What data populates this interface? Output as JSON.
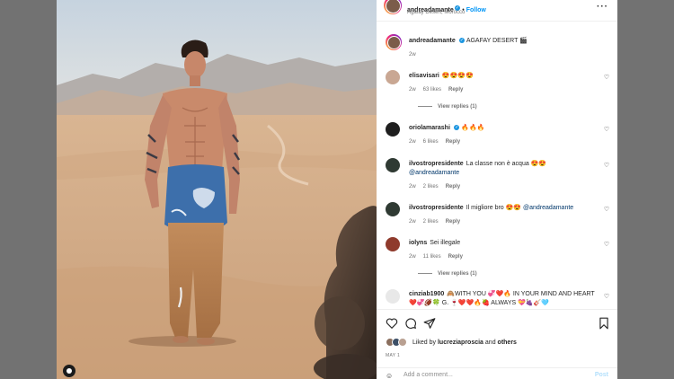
{
  "post": {
    "username": "andreadamante",
    "verified_mark": "✓",
    "separator": "•",
    "follow_label": "Follow",
    "location": "Agafay Desert, Morocco",
    "more_icon": "more-horizontal-icon",
    "caption_text": "AGAFAY DESERT 🎬",
    "caption_age": "2w"
  },
  "comments": [
    {
      "user": "elisavisari",
      "text": "😍😍😍😍",
      "age": "2w",
      "likes": "63 likes",
      "reply": "Reply",
      "view_replies": "View replies (1)"
    },
    {
      "user": "oriolamarashi",
      "verified": "✓",
      "text": "🔥🔥🔥",
      "age": "2w",
      "likes": "6 likes",
      "reply": "Reply"
    },
    {
      "user": "ilvostropresidente",
      "text": "La classe non è acqua 😍😍",
      "mention": "@andreadamante",
      "age": "2w",
      "likes": "2 likes",
      "reply": "Reply"
    },
    {
      "user": "ilvostropresidente",
      "text": "Il migliore bro 😍😍",
      "mention": "@andreadamante",
      "age": "2w",
      "likes": "2 likes",
      "reply": "Reply"
    },
    {
      "user": "iolyns",
      "text": "Sei illegale",
      "age": "2w",
      "likes": "11 likes",
      "reply": "Reply",
      "view_replies": "View replies (1)"
    },
    {
      "user": "cinziab1900",
      "text": "🙈WITH YOU 💞❤️🔥 IN YOUR MIND AND HEART ❤️💞🏈🍀 G. 🍷❤️❤️🔥🍓 ALWAYS 💝🍇🎸🩵"
    }
  ],
  "actions": {
    "like_icon": "heart-outline-icon",
    "comment_icon": "comment-icon",
    "share_icon": "send-icon",
    "save_icon": "bookmark-icon",
    "liked_prefix": "Liked by",
    "liked_user": "lucreziaproscia",
    "liked_and": "and",
    "liked_others": "others",
    "date": "MAY 1",
    "add_comment_placeholder": "Add a comment...",
    "post_label": "Post",
    "emoji_icon": "smiley-icon"
  },
  "colors": {
    "accent": "#0095f6",
    "verified": "#1b95e0",
    "muted": "#737373",
    "backdrop": "#727272"
  }
}
